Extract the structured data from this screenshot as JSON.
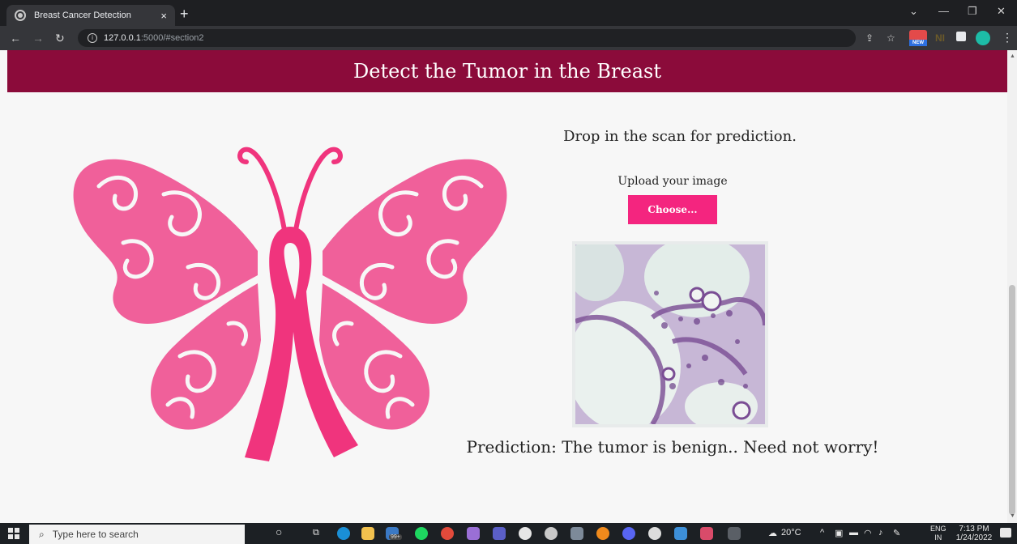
{
  "browser": {
    "tab_title": "Breast Cancer Detection",
    "tab_close": "×",
    "new_tab": "+",
    "url_host": "127.0.0.1",
    "url_path": ":5000/#section2",
    "ext_new_label": "NEW",
    "ext_ni_label": "NI"
  },
  "page": {
    "header_title": "Detect the Tumor in the Breast",
    "drop_text": "Drop in the scan for prediction.",
    "upload_label": "Upload your image",
    "choose_button": "Choose...",
    "prediction": "Prediction: The tumor is benign.. Need not worry!"
  },
  "taskbar": {
    "search_placeholder": "Type here to search",
    "weather": "20°C",
    "lang_top": "ENG",
    "lang_bottom": "IN",
    "time": "7:13 PM",
    "date": "1/24/2022",
    "store_badge": "99+",
    "apps": [
      "cortana-icon",
      "task-view-icon",
      "edge-icon",
      "file-explorer-icon",
      "store-icon",
      "spotify-icon",
      "chrome-icon",
      "app-icon",
      "teams-icon",
      "app-icon",
      "app-icon",
      "app-icon",
      "blender-icon",
      "discord-icon",
      "app-icon",
      "app-icon",
      "app-icon",
      "app-icon"
    ]
  },
  "colors": {
    "header_bg": "#8b0b3a",
    "accent_pink": "#f4257f",
    "butterfly_pink": "#f0609a",
    "ribbon_pink": "#f0347d"
  }
}
